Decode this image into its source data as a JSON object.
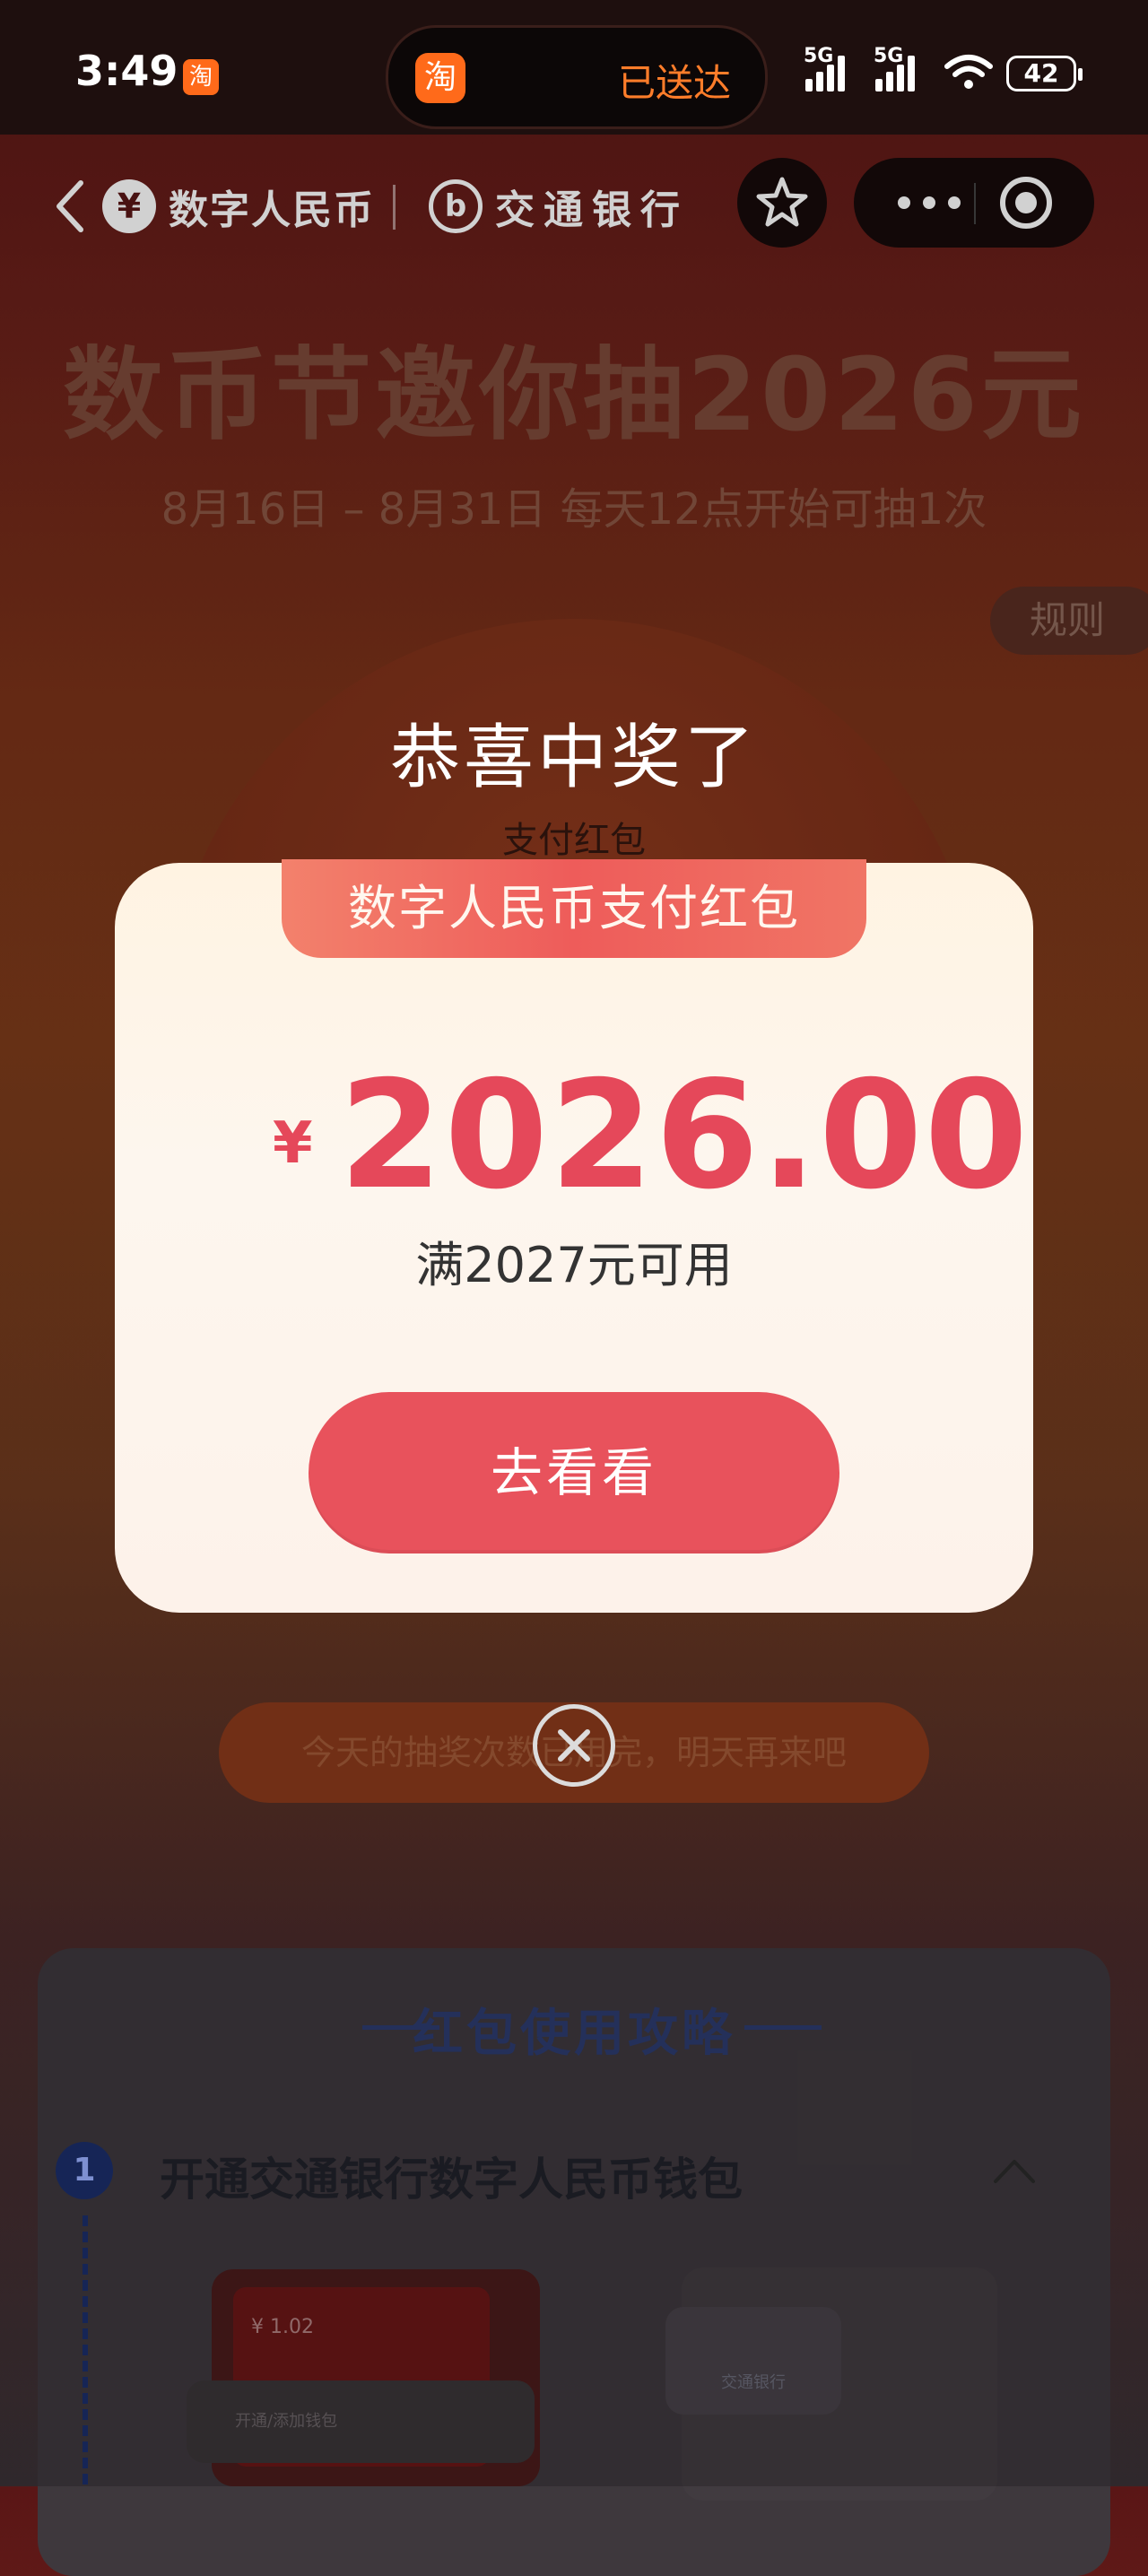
{
  "status_bar": {
    "time": "3:49",
    "app_icon_glyph": "淘",
    "island_text": "已送达",
    "network_1": "5G",
    "network_2": "5G",
    "battery": "42"
  },
  "nav": {
    "brand_1": "数字人民币",
    "brand_1_logo": "¥",
    "brand_2": "交通银行",
    "brand_2_logo": "b"
  },
  "page": {
    "title": "数币节邀你抽2026元",
    "subtitle": "8月16日 – 8月31日  每天12点开始可抽1次",
    "rules": "规则",
    "wheel_label": "支付红包",
    "chance_text": "今天的抽奖次数已用完，明天再来吧"
  },
  "guide": {
    "title": "红包使用攻略",
    "step_number": "1",
    "step_text": "开通交通银行数字人民币钱包",
    "mock_balance": "¥ 1.02",
    "mock_open_button": "开通/添加钱包",
    "mock_bank": "交通银行"
  },
  "modal": {
    "congrats": "恭喜中奖了",
    "banner": "数字人民币支付红包",
    "currency": "¥",
    "amount": "2026.00",
    "usage": "满2027元可用",
    "button": "去看看"
  },
  "colors": {
    "accent_red": "#e5485a",
    "button_red": "#e8525c",
    "banner_red": "#ee5c5a",
    "modal_bg": "#fdf6ee",
    "island_text": "#ff7d2a"
  }
}
